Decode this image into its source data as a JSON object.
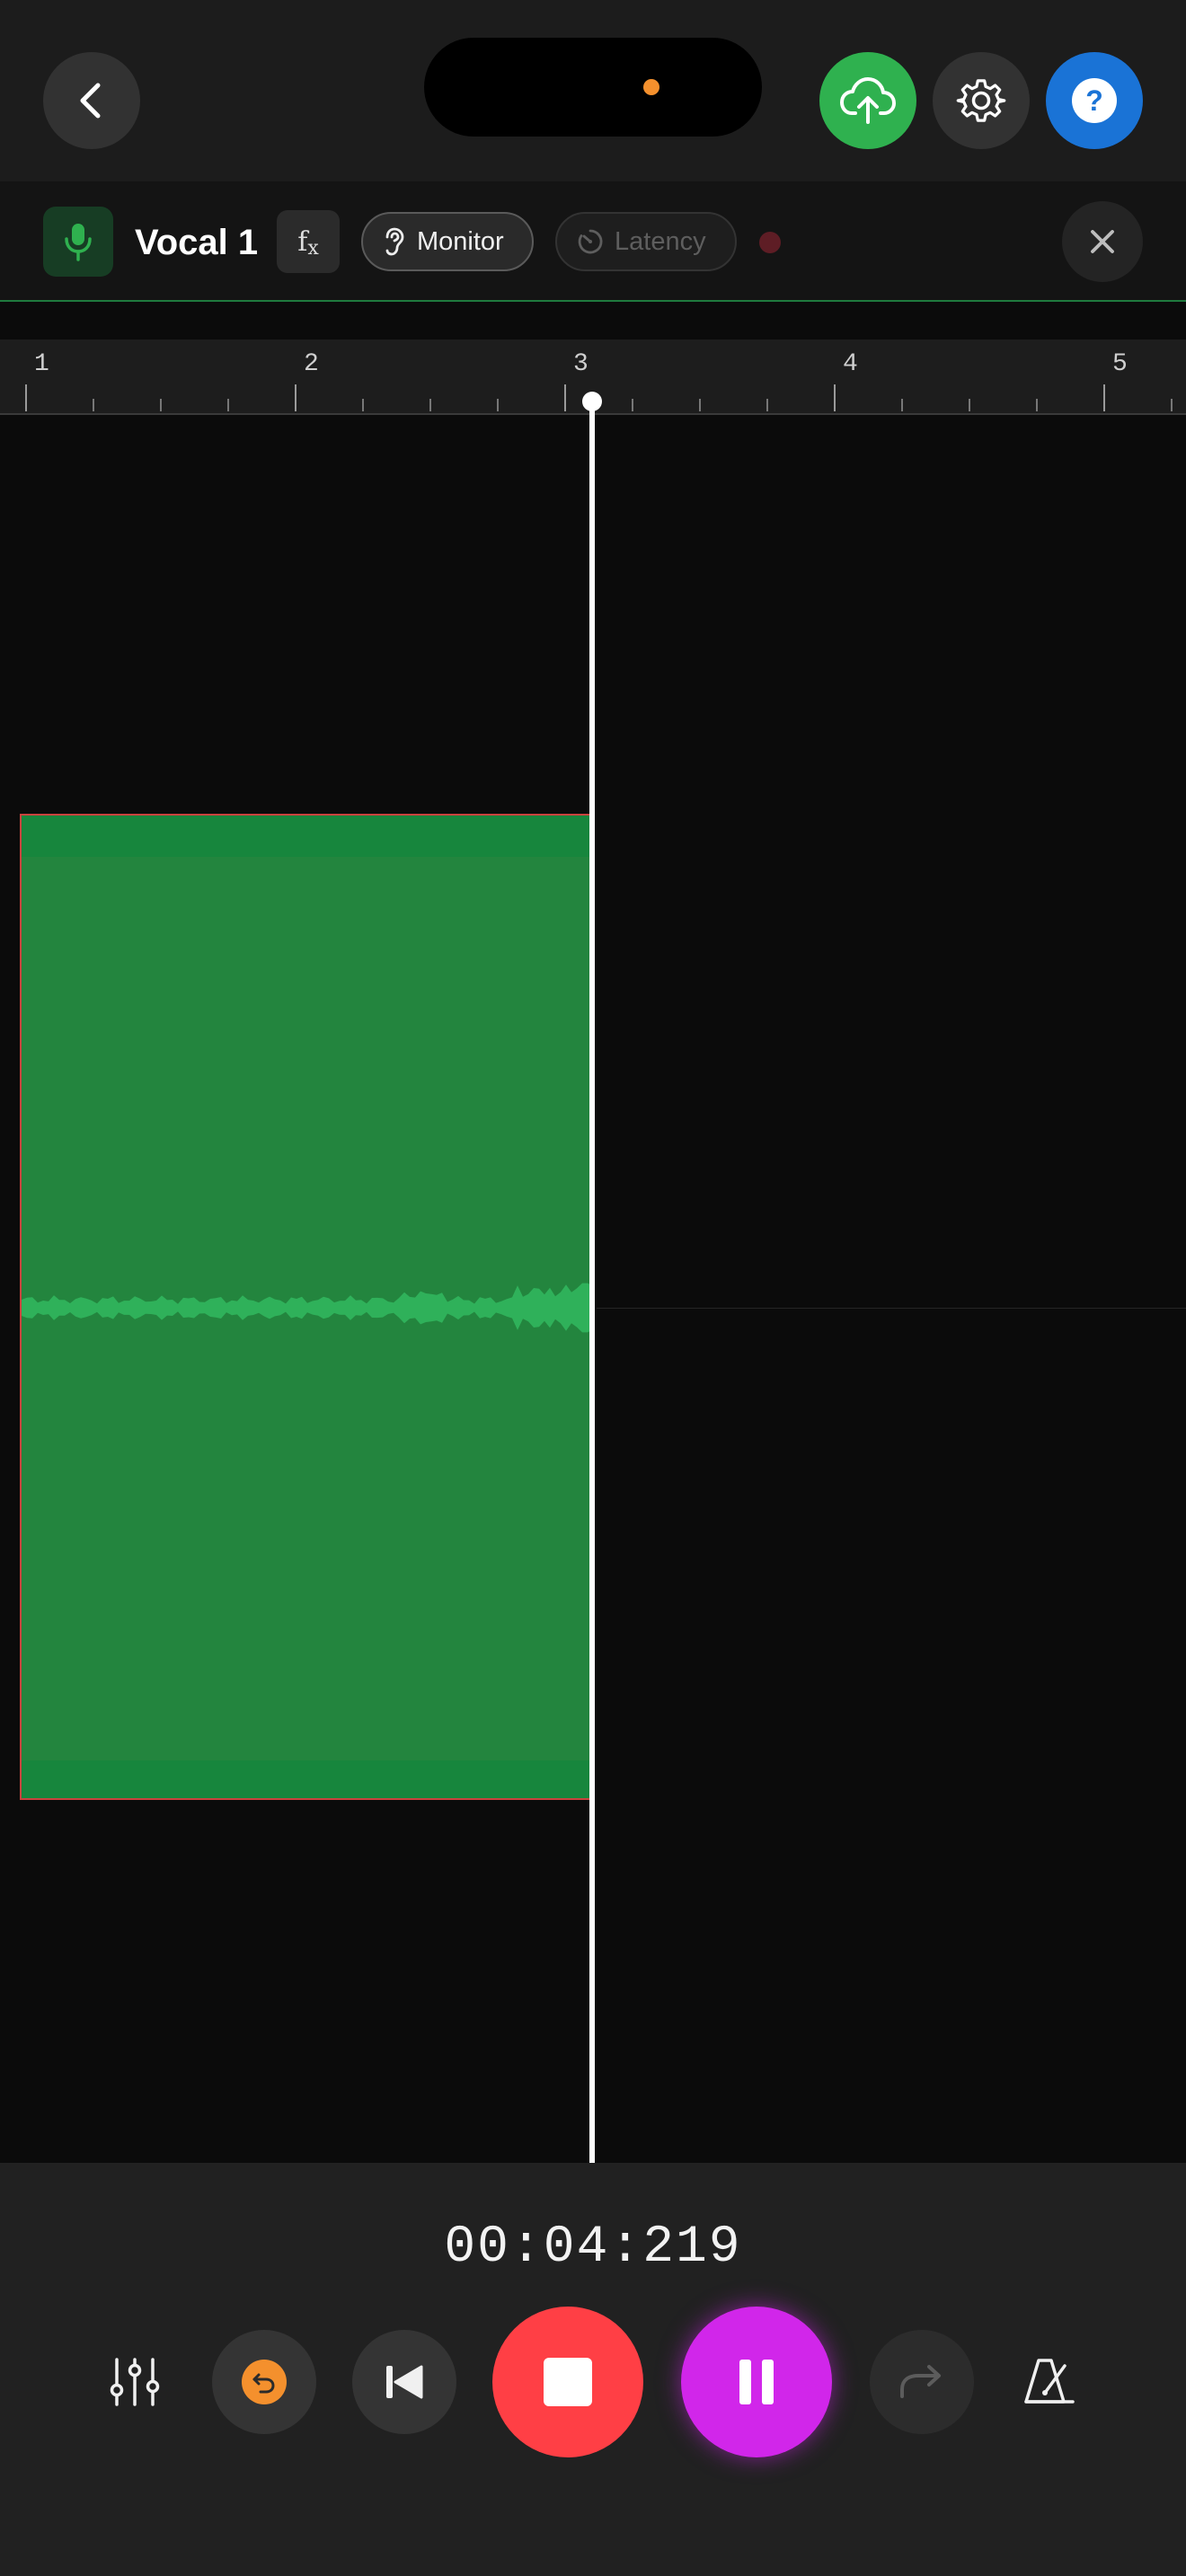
{
  "colors": {
    "accent_green": "#2fb14f",
    "help_blue": "#1a73d6",
    "stop_red": "#ff3f45",
    "pause_magenta": "#d126ea",
    "clip_green": "#23853e",
    "undo_orange": "#f4902d"
  },
  "header": {
    "back_icon": "chevron-left-icon",
    "cloud_icon": "cloud-upload-icon",
    "settings_icon": "gear-icon",
    "help_label": "?"
  },
  "track": {
    "name": "Vocal 1",
    "fx_label": "f",
    "fx_sub": "x",
    "monitor_label": "Monitor",
    "latency_label": "Latency"
  },
  "ruler": {
    "bars": [
      "1",
      "2",
      "3",
      "4",
      "5"
    ]
  },
  "transport": {
    "time": "00:04:219"
  }
}
